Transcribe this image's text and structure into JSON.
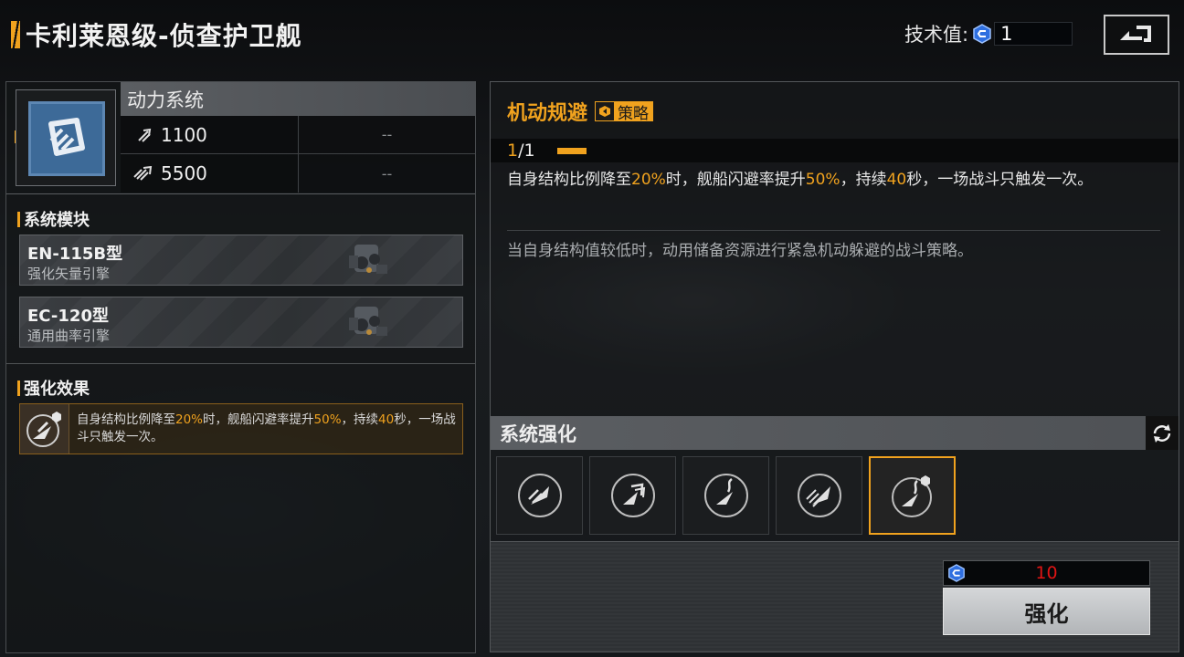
{
  "header": {
    "title": "卡利莱恩级-侦查护卫舰",
    "tech_label": "技术值:",
    "tech_value": "1"
  },
  "system": {
    "name": "动力系统",
    "stats": [
      {
        "value": "1100",
        "secondary": "--"
      },
      {
        "value": "5500",
        "secondary": "--"
      }
    ]
  },
  "modules_section": {
    "title": "系统模块",
    "items": [
      {
        "name": "EN-115B型",
        "desc": "强化矢量引擎"
      },
      {
        "name": "EC-120型",
        "desc": "通用曲率引擎"
      }
    ]
  },
  "effect_section": {
    "title": "强化效果",
    "text_parts": [
      "自身结构比例降至",
      "20%",
      "时，舰船闪避率提升",
      "50%",
      "，持续",
      "40",
      "秒，一场战斗只触发一次。"
    ]
  },
  "skill": {
    "title": "机动规避",
    "badge": "策略",
    "level_current": "1",
    "level_rest": "/1",
    "desc_parts": [
      "自身结构比例降至",
      "20%",
      "时，舰船闪避率提升",
      "50%",
      "，持续",
      "40",
      "秒，一场战斗只触发一次。"
    ],
    "flavor": "当自身结构值较低时，动用储备资源进行紧急机动躲避的战斗策略。"
  },
  "enhance": {
    "title": "系统强化",
    "slots": [
      "engine-dash-icon",
      "engine-boost-icon",
      "engine-swerve-icon",
      "engine-speed-icon",
      "engine-evade-icon"
    ],
    "active_slot": 4,
    "cost": "10",
    "button_label": "强化"
  },
  "colors": {
    "accent": "#f0a21e",
    "cost_red": "#e01414",
    "icon_blue": "#3d6a98"
  }
}
